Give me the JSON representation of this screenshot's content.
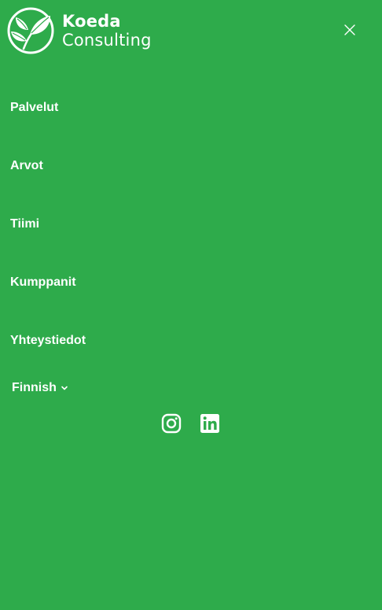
{
  "brand": {
    "name_line1": "Koeda",
    "name_line2": "Consulting",
    "logo_icon": "leaf-logo-icon"
  },
  "header": {
    "close_icon": "close-icon"
  },
  "nav": {
    "items": [
      {
        "label": "Palvelut"
      },
      {
        "label": "Arvot"
      },
      {
        "label": "Tiimi"
      },
      {
        "label": "Kumppanit"
      },
      {
        "label": "Yhteystiedot"
      }
    ]
  },
  "language": {
    "selected": "Finnish",
    "icon": "chevron-down-icon"
  },
  "social": {
    "icons": [
      "instagram-icon",
      "linkedin-icon"
    ]
  },
  "colors": {
    "background": "#2eab4b",
    "foreground": "#ffffff"
  }
}
